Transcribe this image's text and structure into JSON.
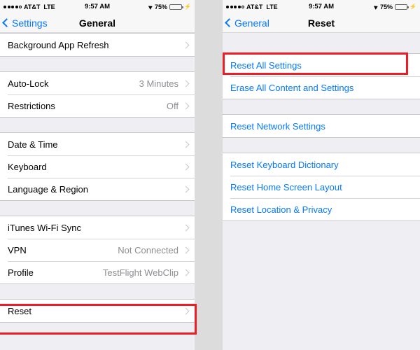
{
  "left_screen": {
    "status_bar": {
      "signal_dots_filled": 4,
      "signal_dots_total": 5,
      "carrier": "AT&T",
      "network": "LTE",
      "time": "9:57 AM",
      "location_icon": "location-arrow-icon",
      "battery_percent": "75%",
      "battery_level": 75,
      "charging_icon": "lightning-bolt-icon"
    },
    "nav": {
      "back_label": "Settings",
      "title": "General",
      "back_icon": "chevron-left-icon"
    },
    "groups": [
      {
        "rows": [
          {
            "label": "Background App Refresh",
            "value": "",
            "accessory": "chevron-right-icon"
          }
        ]
      },
      {
        "rows": [
          {
            "label": "Auto-Lock",
            "value": "3 Minutes",
            "accessory": "chevron-right-icon"
          },
          {
            "label": "Restrictions",
            "value": "Off",
            "accessory": "chevron-right-icon"
          }
        ]
      },
      {
        "rows": [
          {
            "label": "Date & Time",
            "value": "",
            "accessory": "chevron-right-icon"
          },
          {
            "label": "Keyboard",
            "value": "",
            "accessory": "chevron-right-icon"
          },
          {
            "label": "Language & Region",
            "value": "",
            "accessory": "chevron-right-icon"
          }
        ]
      },
      {
        "rows": [
          {
            "label": "iTunes Wi-Fi Sync",
            "value": "",
            "accessory": "chevron-right-icon"
          },
          {
            "label": "VPN",
            "value": "Not Connected",
            "accessory": "chevron-right-icon"
          },
          {
            "label": "Profile",
            "value": "TestFlight WebClip",
            "accessory": "chevron-right-icon"
          }
        ]
      },
      {
        "rows": [
          {
            "label": "Reset",
            "value": "",
            "accessory": "chevron-right-icon"
          }
        ]
      }
    ]
  },
  "right_screen": {
    "status_bar": {
      "signal_dots_filled": 4,
      "signal_dots_total": 5,
      "carrier": "AT&T",
      "network": "LTE",
      "time": "9:57 AM",
      "location_icon": "location-arrow-icon",
      "battery_percent": "75%",
      "battery_level": 75,
      "charging_icon": "lightning-bolt-icon"
    },
    "nav": {
      "back_label": "General",
      "title": "Reset",
      "back_icon": "chevron-left-icon"
    },
    "groups": [
      {
        "rows": [
          {
            "label": "Reset All Settings"
          },
          {
            "label": "Erase All Content and Settings"
          }
        ]
      },
      {
        "rows": [
          {
            "label": "Reset Network Settings"
          }
        ]
      },
      {
        "rows": [
          {
            "label": "Reset Keyboard Dictionary"
          },
          {
            "label": "Reset Home Screen Layout"
          },
          {
            "label": "Reset Location & Privacy"
          }
        ]
      }
    ]
  },
  "annotations": {
    "highlight_color": "#ee1c25",
    "highlighted_left": "Reset",
    "highlighted_right": "Reset All Settings"
  },
  "colors": {
    "accent_blue": "#0579ff",
    "value_gray": "#8e8e93",
    "list_background": "#efeef3",
    "row_background": "#ffffff",
    "battery_green": "#4cd764"
  }
}
